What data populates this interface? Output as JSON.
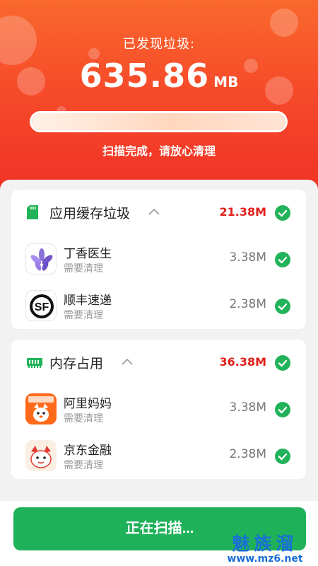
{
  "header": {
    "found_label": "已发现垃圾:",
    "amount": "635.86",
    "unit": "MB",
    "progress": 1.0,
    "status": "扫描完成，请放心清理"
  },
  "sections": [
    {
      "title": "应用缓存垃圾",
      "icon": "sd-card-icon",
      "size": "21.38M",
      "checked": true,
      "items": [
        {
          "name": "丁香医生",
          "sub": "需要清理",
          "size": "3.38M",
          "icon": "dingxiang-doctor-app-icon",
          "checked": true
        },
        {
          "name": "顺丰速递",
          "sub": "需要清理",
          "size": "2.38M",
          "icon": "sf-express-app-icon",
          "checked": true
        }
      ]
    },
    {
      "title": "内存占用",
      "icon": "memory-chip-icon",
      "size": "36.38M",
      "checked": true,
      "items": [
        {
          "name": "阿里妈妈",
          "sub": "需要清理",
          "size": "3.38M",
          "icon": "alimama-app-icon",
          "checked": true
        },
        {
          "name": "京东金融",
          "sub": "需要清理",
          "size": "2.38M",
          "icon": "jd-finance-app-icon",
          "checked": true
        }
      ]
    }
  ],
  "scan_button": "正在扫描...",
  "watermark": {
    "main": "魅族溜",
    "url": "www.mz6.net"
  },
  "colors": {
    "hero_top": "#f9682c",
    "hero_bottom": "#ef2f25",
    "accent_green": "#1fb15a",
    "size_red": "#e0201b"
  }
}
